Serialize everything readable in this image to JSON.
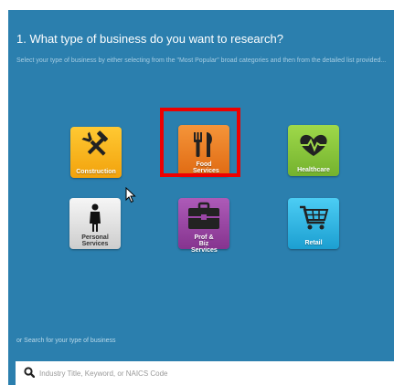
{
  "header": {
    "title": "1. What type of business do you want to research?",
    "subtitle": "Select your type of business by either selecting from the \"Most Popular\" broad categories and then from the detailed list provided..."
  },
  "categories": [
    {
      "label": "Construction",
      "color": "#f5b418",
      "icon": "tools-icon"
    },
    {
      "label": "Food Services",
      "color": "#ef7f22",
      "icon": "fork-knife-icon"
    },
    {
      "label": "Healthcare",
      "color": "#8cc63f",
      "icon": "heart-pulse-icon"
    },
    {
      "label": "Personal Services",
      "color": "#e3e3e3",
      "icon": "person-icon"
    },
    {
      "label": "Prof & Biz Services",
      "color": "#9b46a6",
      "icon": "briefcase-icon"
    },
    {
      "label": "Retail",
      "color": "#2fb6e4",
      "icon": "shopping-cart-icon"
    }
  ],
  "search": {
    "label": "or Search for your type of business",
    "placeholder": "Industry Title, Keyword, or NAICS Code"
  },
  "colors": {
    "panel_background": "#2b7fae",
    "highlight_border": "#ee0000"
  }
}
